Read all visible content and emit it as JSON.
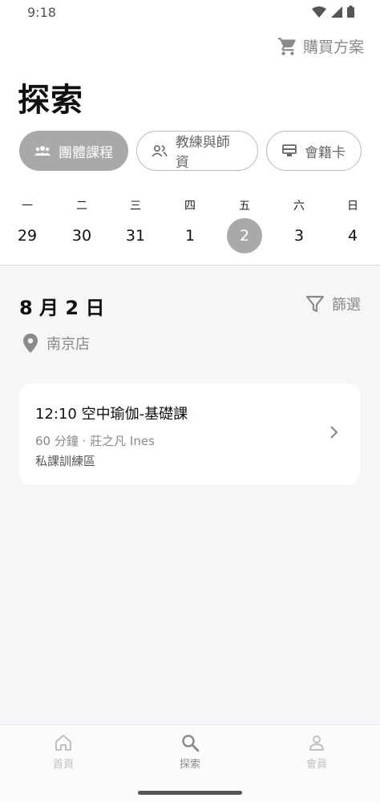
{
  "status_bar": {
    "time": "9:18"
  },
  "header": {
    "buy_plan_label": "購買方案",
    "title": "探索"
  },
  "tabs": [
    {
      "label": "團體課程",
      "icon": "group-icon",
      "active": true
    },
    {
      "label": "教練與師資",
      "icon": "people-icon",
      "active": false
    },
    {
      "label": "會籍卡",
      "icon": "card-icon",
      "active": false
    }
  ],
  "week": [
    {
      "weekday": "一",
      "day": "29"
    },
    {
      "weekday": "二",
      "day": "30"
    },
    {
      "weekday": "三",
      "day": "31"
    },
    {
      "weekday": "四",
      "day": "1"
    },
    {
      "weekday": "五",
      "day": "2",
      "selected": true
    },
    {
      "weekday": "六",
      "day": "3"
    },
    {
      "weekday": "日",
      "day": "4"
    }
  ],
  "schedule": {
    "date_heading": "8 月 2 日",
    "filter_label": "篩選",
    "location": "南京店",
    "classes": [
      {
        "title": "12:10 空中瑜伽-基礎課",
        "meta": "60 分鐘 · 莊之凡 Ines",
        "room": "私課訓練區"
      }
    ]
  },
  "bottom_nav": [
    {
      "label": "首頁",
      "icon": "home-icon",
      "active": false
    },
    {
      "label": "探索",
      "icon": "search-icon",
      "active": true
    },
    {
      "label": "會員",
      "icon": "user-icon",
      "active": false
    }
  ],
  "colors": {
    "accent_gray": "#a9a9ab",
    "muted_text": "#8a8a8a",
    "background": "#f6f5f8"
  }
}
